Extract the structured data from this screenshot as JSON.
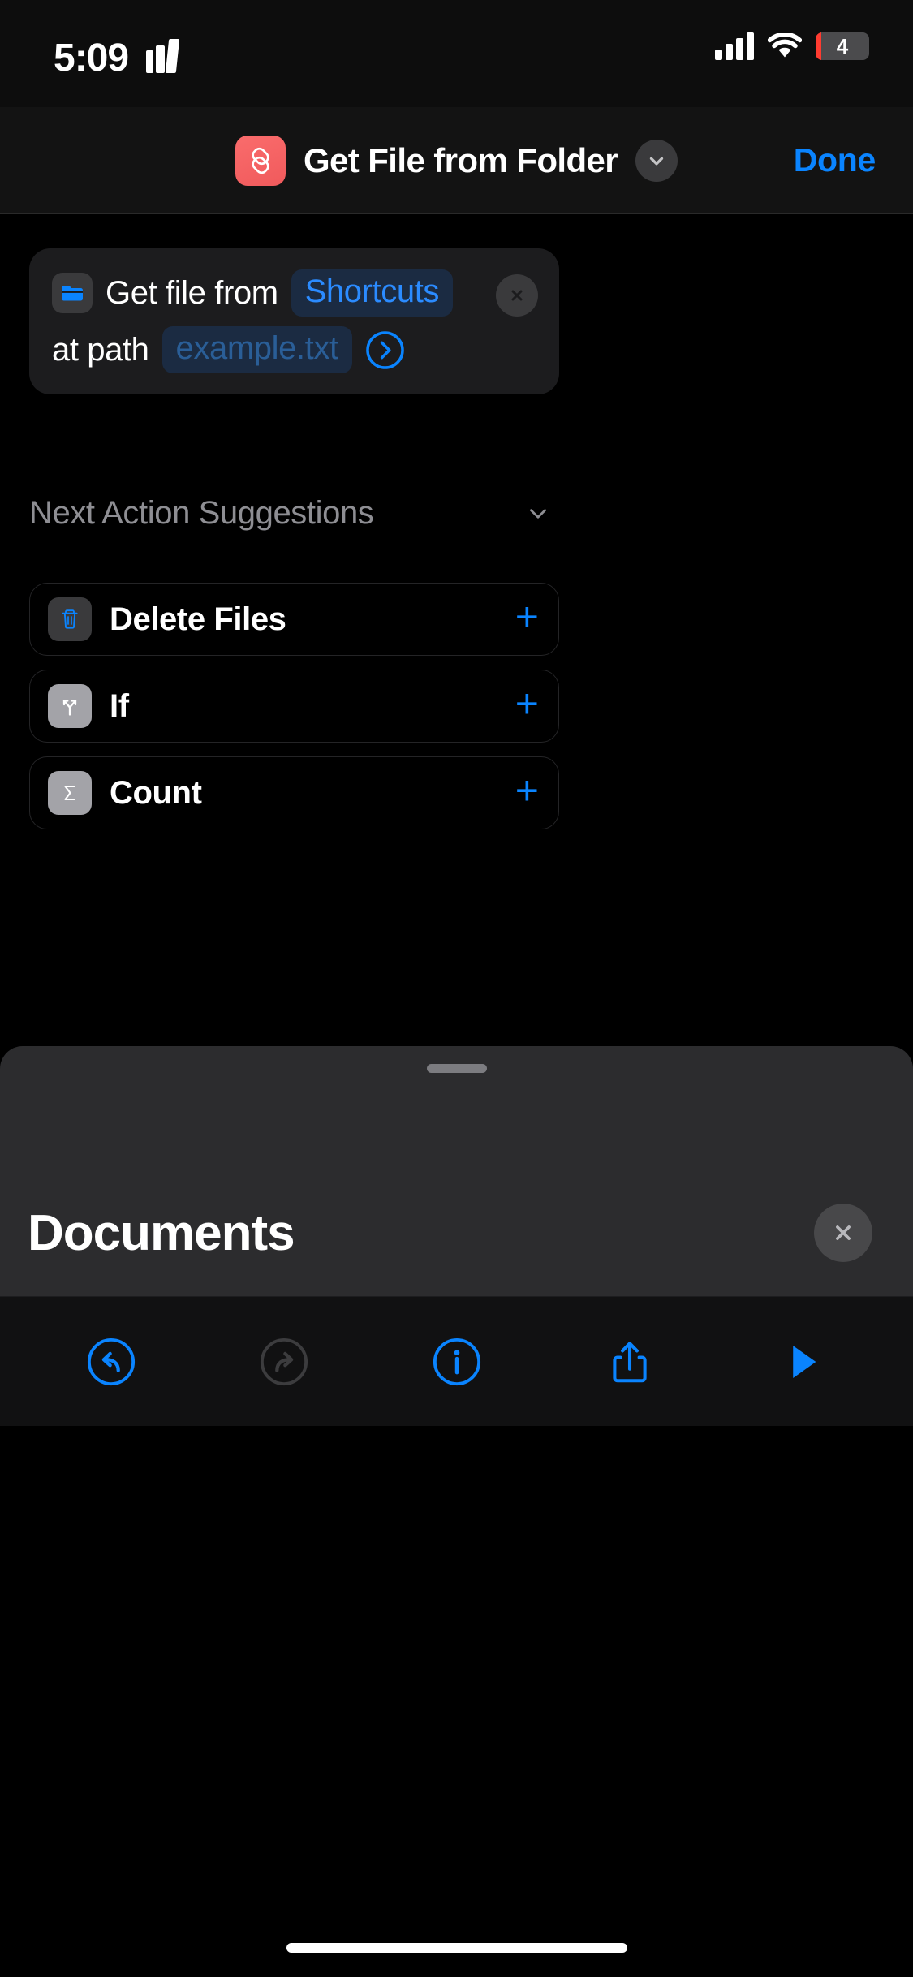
{
  "status_bar": {
    "time": "5:09",
    "books_icon": "books-icon",
    "cellular_icon": "cellular-signal-icon",
    "wifi_icon": "wifi-icon",
    "battery_level": "4",
    "battery_low_color": "#ff3b30"
  },
  "nav_bar": {
    "shortcut_icon": "shortcuts-app-icon",
    "title": "Get File from Folder",
    "chevron_icon": "chevron-down-icon",
    "done_label": "Done"
  },
  "action_card": {
    "icon": "folder-icon",
    "text_before": "Get file from",
    "source_token": "Shortcuts",
    "text_path_label": "at path",
    "path_placeholder": "example.txt",
    "disclosure_icon": "chevron-right-circle-icon",
    "close_icon": "close-icon",
    "accent": "#0a84ff"
  },
  "suggestions": {
    "header": "Next Action Suggestions",
    "collapse_icon": "chevron-down-icon",
    "add_symbol": "+",
    "items": [
      {
        "label": "Delete Files",
        "icon": "trash-icon",
        "icon_style": "grey-dark"
      },
      {
        "label": "If",
        "icon": "branch-icon",
        "icon_style": "grey-light"
      },
      {
        "label": "Count",
        "icon": "sigma-icon",
        "icon_style": "grey-light"
      }
    ]
  },
  "sheet": {
    "grabber": "sheet-grabber",
    "title": "Documents",
    "close_icon": "close-icon",
    "toolbar": [
      {
        "name": "undo-button",
        "icon": "undo-icon",
        "enabled": true
      },
      {
        "name": "redo-button",
        "icon": "redo-icon",
        "enabled": false
      },
      {
        "name": "info-button",
        "icon": "info-circle-icon",
        "enabled": true
      },
      {
        "name": "share-button",
        "icon": "share-icon",
        "enabled": true
      },
      {
        "name": "run-button",
        "icon": "play-icon",
        "enabled": true
      }
    ]
  }
}
